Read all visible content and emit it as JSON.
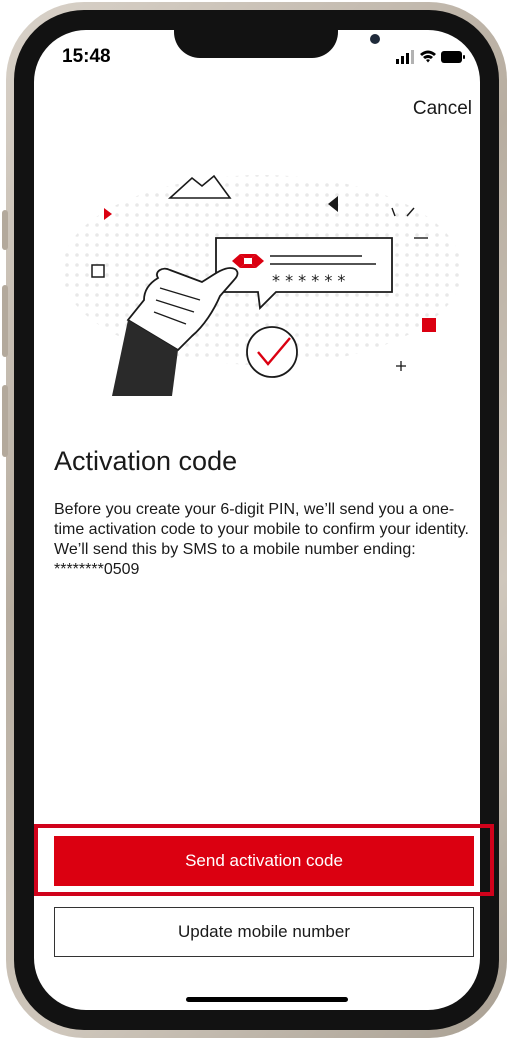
{
  "status_bar": {
    "time": "15:48"
  },
  "header": {
    "cancel_label": "Cancel"
  },
  "illustration": {
    "masked_code": "* * * * * *"
  },
  "content": {
    "title": "Activation code",
    "description": "Before you create your 6-digit PIN, we’ll send you a one-time activation code to your mobile to confirm your identity.",
    "sms_line": "We’ll send this by SMS to a mobile number ending: ********0509"
  },
  "actions": {
    "primary_label": "Send activation code",
    "secondary_label": "Update mobile number"
  },
  "colors": {
    "brand_red": "#db0011",
    "highlight_red": "#d0021b"
  }
}
